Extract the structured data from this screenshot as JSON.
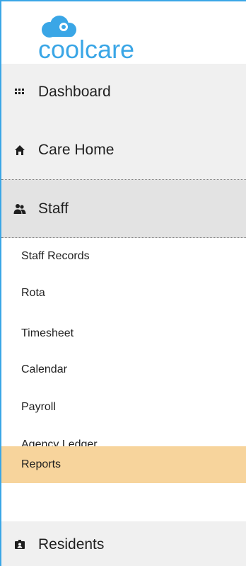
{
  "logo": {
    "text": "coolcare",
    "accent": "#3aa6e6"
  },
  "nav": {
    "dashboard": {
      "label": "Dashboard",
      "icon": "grid-dots-icon"
    },
    "care_home": {
      "label": "Care Home",
      "icon": "home-icon"
    },
    "staff": {
      "label": "Staff",
      "icon": "users-icon"
    },
    "residents": {
      "label": "Residents",
      "icon": "id-card-icon"
    }
  },
  "staff_submenu": {
    "items": [
      {
        "label": "Staff Records"
      },
      {
        "label": "Rota"
      },
      {
        "label": "Timesheet"
      },
      {
        "label": "Calendar"
      },
      {
        "label": "Payroll"
      },
      {
        "label": "Agency Ledger"
      },
      {
        "label": "Reports",
        "active": true
      }
    ]
  },
  "colors": {
    "active_highlight": "#f7d49c",
    "nav_background": "#f0f0f0",
    "staff_background": "#e3e3e3",
    "border_accent": "#3aa6e6"
  }
}
